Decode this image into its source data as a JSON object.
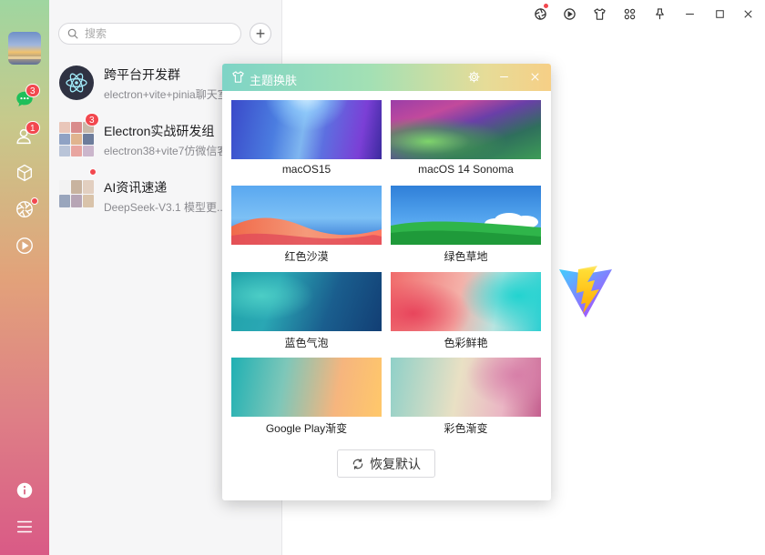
{
  "sidebar": {
    "chat_badge": "3",
    "contacts_badge": "1"
  },
  "search": {
    "placeholder": "搜索"
  },
  "sessions": [
    {
      "name": "跨平台开发群",
      "preview": "electron+vite+pinia聊天室"
    },
    {
      "name": "Electron实战研发组",
      "preview": "electron38+vite7仿微信客",
      "badge": "3"
    },
    {
      "name": "AI资讯速递",
      "preview": "DeepSeek-V3.1 模型更..."
    }
  ],
  "dialog": {
    "title": "主题换肤",
    "themes": [
      {
        "label": "macOS15"
      },
      {
        "label": "macOS 14 Sonoma"
      },
      {
        "label": "红色沙漠"
      },
      {
        "label": "绿色草地"
      },
      {
        "label": "蓝色气泡"
      },
      {
        "label": "色彩鲜艳"
      },
      {
        "label": "Google Play渐变"
      },
      {
        "label": "彩色渐变"
      }
    ],
    "restore_label": "恢复默认"
  },
  "colors": {
    "accent_red": "#f2484f",
    "dialog_header_start": "#7ed4c6",
    "dialog_header_end": "#f6cf86"
  }
}
